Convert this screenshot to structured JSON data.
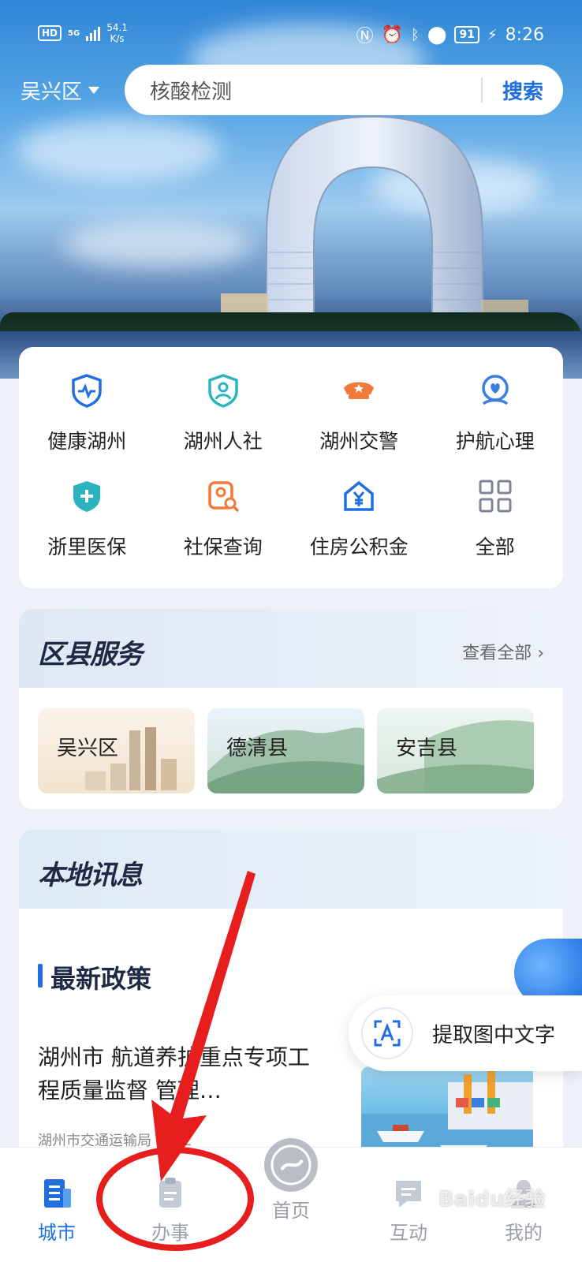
{
  "status_bar": {
    "hd": "HD",
    "network": "5G",
    "speed_value": "54.1",
    "speed_unit": "K/s",
    "battery": "91",
    "time": "8:26"
  },
  "header": {
    "district": "吴兴区",
    "search_placeholder": "核酸检测",
    "search_button": "搜索"
  },
  "services": [
    {
      "label": "健康湖州",
      "icon": "heart-shield-icon",
      "color": "#1f6fe0"
    },
    {
      "label": "湖州人社",
      "icon": "person-shield-icon",
      "color": "#2bb3c0"
    },
    {
      "label": "湖州交警",
      "icon": "police-cap-icon",
      "color": "#f07a3a"
    },
    {
      "label": "护航心理",
      "icon": "heart-bubble-icon",
      "color": "#3a7ee0"
    },
    {
      "label": "浙里医保",
      "icon": "medical-shield-icon",
      "color": "#2bb3c0"
    },
    {
      "label": "社保查询",
      "icon": "person-search-icon",
      "color": "#f07a3a"
    },
    {
      "label": "住房公积金",
      "icon": "house-yuan-icon",
      "color": "#1f6fe0"
    },
    {
      "label": "全部",
      "icon": "grid-icon",
      "color": "#7d8593"
    }
  ],
  "district_section": {
    "title": "区县服务",
    "more": "查看全部",
    "items": [
      {
        "name": "吴兴区"
      },
      {
        "name": "德清县"
      },
      {
        "name": "安吉县"
      }
    ]
  },
  "news_section": {
    "title": "本地讯息",
    "subtitle": "最新政策",
    "headline": "湖州市 航道养护重点专项工程质量监督 管理…",
    "source": "湖州市交通运输局 2022"
  },
  "ocr_button": {
    "label": "提取图中文字"
  },
  "tabs": [
    {
      "label": "城市",
      "icon": "city-icon",
      "active": true
    },
    {
      "label": "办事",
      "icon": "clipboard-icon",
      "active": false
    },
    {
      "label": "首页",
      "icon": "home-logo-icon",
      "active": false
    },
    {
      "label": "互动",
      "icon": "chat-icon",
      "active": false
    },
    {
      "label": "我的",
      "icon": "person-icon",
      "active": false
    }
  ],
  "watermark": "Baidu经验",
  "colors": {
    "accent": "#1f6fe0",
    "annotation": "#e61e1e"
  }
}
